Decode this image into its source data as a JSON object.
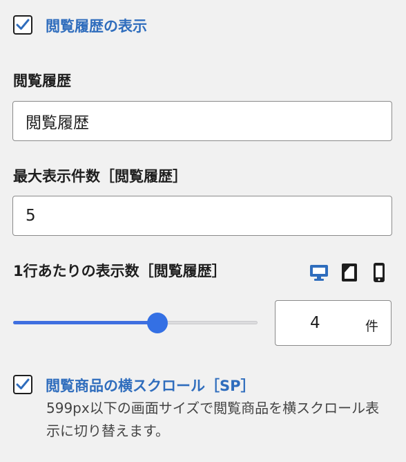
{
  "history_display": {
    "checked": true,
    "label": "閲覧履歴の表示"
  },
  "history_title": {
    "label": "閲覧履歴",
    "value": "閲覧履歴"
  },
  "max_items": {
    "label": "最大表示件数［閲覧履歴］",
    "value": "5"
  },
  "per_row": {
    "label": "1行あたりの表示数［閲覧履歴］",
    "devices": [
      {
        "name": "desktop-icon",
        "active": true
      },
      {
        "name": "tablet-icon",
        "active": false
      },
      {
        "name": "mobile-icon",
        "active": false
      }
    ],
    "slider": {
      "min": 1,
      "max": 6,
      "value": 4
    },
    "value": "4",
    "unit": "件"
  },
  "horizontal_scroll": {
    "checked": true,
    "label": "閲覧商品の横スクロール［SP］",
    "help": "599px以下の画面サイズで閲覧商品を横スクロール表示に切り替えます。"
  },
  "colors": {
    "accent": "#2f6dbd",
    "slider": "#3470e4",
    "background": "#f1f1f1"
  }
}
